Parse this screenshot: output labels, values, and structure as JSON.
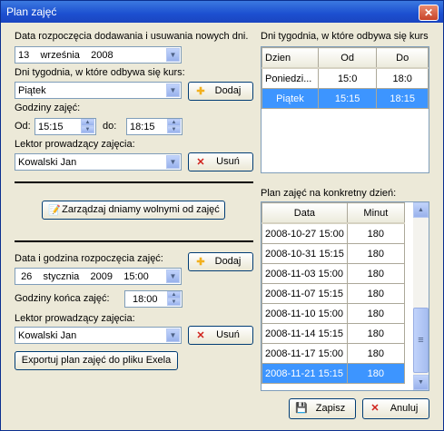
{
  "window": {
    "title": "Plan zajęć",
    "close_glyph": "✕"
  },
  "upper": {
    "start_date_label": "Data rozpoczęcia dodawania i usuwania nowych dni.",
    "start_date": {
      "day": "13",
      "month": "września",
      "year": "2008"
    },
    "weekday_label": "Dni tygodnia, w które odbywa się kurs:",
    "weekday_value": "Piątek",
    "add_label": "Dodaj",
    "hours_label": "Godziny zajęć:",
    "from_label": "Od:",
    "from_value": "15:15",
    "to_label": "do:",
    "to_value": "18:15",
    "lector_label": "Lektor prowadzący zajęcia:",
    "lector_value": "Kowalski Jan",
    "remove_label": "Usuń"
  },
  "weekdays_table": {
    "label": "Dni tygodnia, w które odbywa się kurs",
    "headers": [
      "Dzien",
      "Od",
      "Do"
    ],
    "rows": [
      [
        "Poniedzi...",
        "15:0",
        "18:0"
      ],
      [
        "Piątek",
        "15:15",
        "18:15"
      ]
    ],
    "selected_row": 1
  },
  "free_days_button": "Zarządzaj dniamy wolnymi od zajęć",
  "lower": {
    "datetime_label": "Data i godzina rozpoczęcia zajęć:",
    "datetime": {
      "day": "26",
      "month": "stycznia",
      "year": "2009",
      "time": "15:00"
    },
    "end_label": "Godziny końca zajęć:",
    "end_value": "18:00",
    "lector_label": "Lektor prowadzący zajęcia:",
    "lector_value": "Kowalski Jan",
    "add_label": "Dodaj",
    "remove_label": "Usuń",
    "export_label": "Exportuj plan zajęć do pliku Exela"
  },
  "schedule_table": {
    "label": "Plan zajęć na konkretny dzień:",
    "headers": [
      "Data",
      "Minut"
    ],
    "rows": [
      [
        "2008-10-27 15:00",
        "180"
      ],
      [
        "2008-10-31 15:15",
        "180"
      ],
      [
        "2008-11-03 15:00",
        "180"
      ],
      [
        "2008-11-07 15:15",
        "180"
      ],
      [
        "2008-11-10 15:00",
        "180"
      ],
      [
        "2008-11-14 15:15",
        "180"
      ],
      [
        "2008-11-17 15:00",
        "180"
      ],
      [
        "2008-11-21 15:15",
        "180"
      ]
    ],
    "selected_row": 7,
    "scroll": {
      "up_glyph": "▲",
      "down_glyph": "▼",
      "thumb_glyph": "≡"
    }
  },
  "footer": {
    "save_label": "Zapisz",
    "cancel_label": "Anuluj"
  },
  "icons": {
    "add": "✚",
    "remove": "✕",
    "calendar": "📝",
    "floppy": "💾",
    "dropdown": "▼",
    "spin_up": "▲",
    "spin_down": "▼"
  },
  "colors": {
    "selection": "#3d95ff",
    "titlebar": "#1c4fd0",
    "add_icon": "#f2b01e",
    "remove_icon": "#d0201a"
  }
}
